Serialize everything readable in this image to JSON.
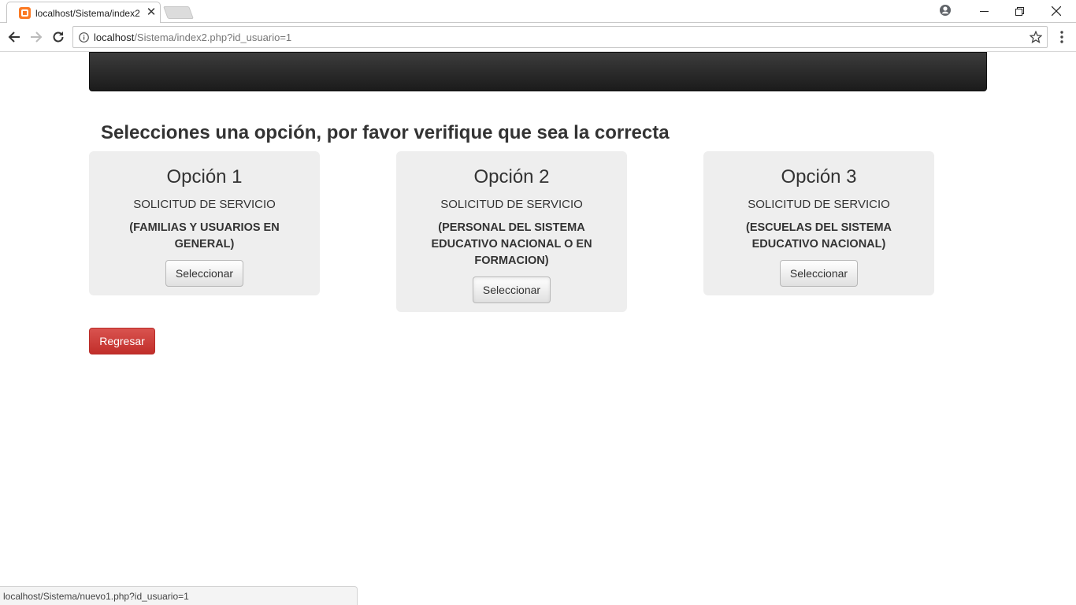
{
  "browser": {
    "tab_title": "localhost/Sistema/index2",
    "url_host": "localhost",
    "url_path": "/Sistema/index2.php?id_usuario=1",
    "status_url": "localhost/Sistema/nuevo1.php?id_usuario=1"
  },
  "page": {
    "heading": "Selecciones una opción, por favor verifique que sea la correcta",
    "options": [
      {
        "title": "Opción 1",
        "subtitle": "SOLICITUD DE SERVICIO",
        "description": "(FAMILIAS Y USUARIOS EN GENERAL)",
        "button_label": "Seleccionar"
      },
      {
        "title": "Opción 2",
        "subtitle": "SOLICITUD DE SERVICIO",
        "description": "(PERSONAL DEL SISTEMA EDUCATIVO NACIONAL O EN FORMACION)",
        "button_label": "Seleccionar"
      },
      {
        "title": "Opción 3",
        "subtitle": "SOLICITUD DE SERVICIO",
        "description": "(ESCUELAS DEL SISTEMA EDUCATIVO NACIONAL)",
        "button_label": "Seleccionar"
      }
    ],
    "back_label": "Regresar"
  }
}
